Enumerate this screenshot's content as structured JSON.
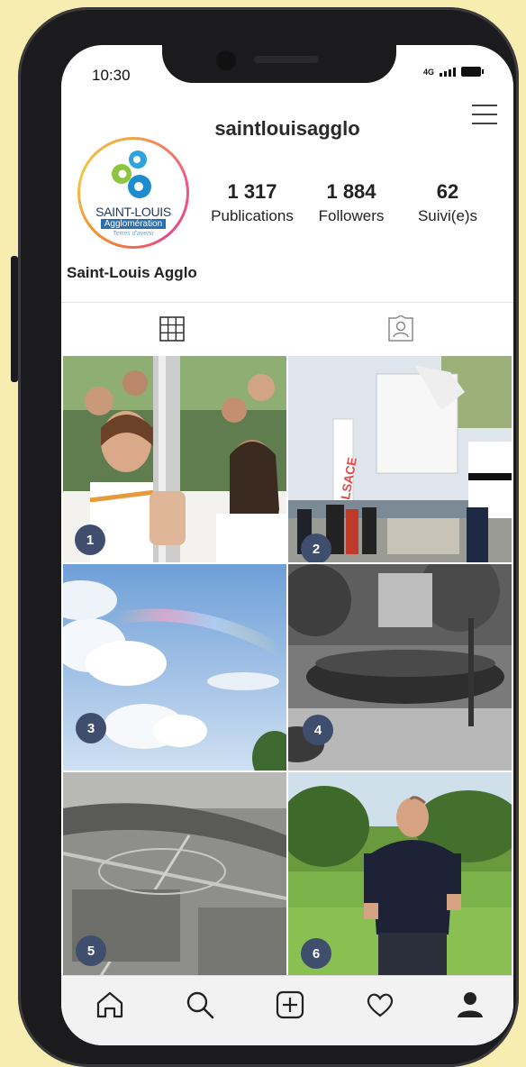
{
  "status": {
    "time": "10:30",
    "network": "4G"
  },
  "profile": {
    "username": "saintlouisagglo",
    "display_name": "Saint-Louis Agglo",
    "logo": {
      "line1": "SAINT-LOUIS",
      "line2": "Agglomération",
      "line3": "Terres d'avenir"
    },
    "stats": [
      {
        "value": "1 317",
        "label": "Publications"
      },
      {
        "value": "1 884",
        "label": "Followers"
      },
      {
        "value": "62",
        "label": "Suivi(e)s"
      }
    ]
  },
  "tabs": [
    {
      "icon": "grid-icon",
      "active": true
    },
    {
      "icon": "tagged-person-icon",
      "active": false
    }
  ],
  "posts": [
    {
      "badge": "1",
      "subject": "youth holding olympic torch"
    },
    {
      "badge": "2",
      "subject": "inauguration ceremony with ALSACE flag"
    },
    {
      "badge": "3",
      "subject": "sky with rainbow and clouds"
    },
    {
      "badge": "4",
      "subject": "archival crowd photo"
    },
    {
      "badge": "5",
      "subject": "archival aerial view"
    },
    {
      "badge": "6",
      "subject": "man standing in wheat field"
    }
  ],
  "bottom_nav": [
    {
      "icon": "home-icon"
    },
    {
      "icon": "search-icon"
    },
    {
      "icon": "add-post-icon"
    },
    {
      "icon": "heart-icon"
    },
    {
      "icon": "profile-icon"
    }
  ],
  "colors": {
    "background": "#f8edb0",
    "phone": "#1b1b1d",
    "badge": "#3e4e6c"
  }
}
